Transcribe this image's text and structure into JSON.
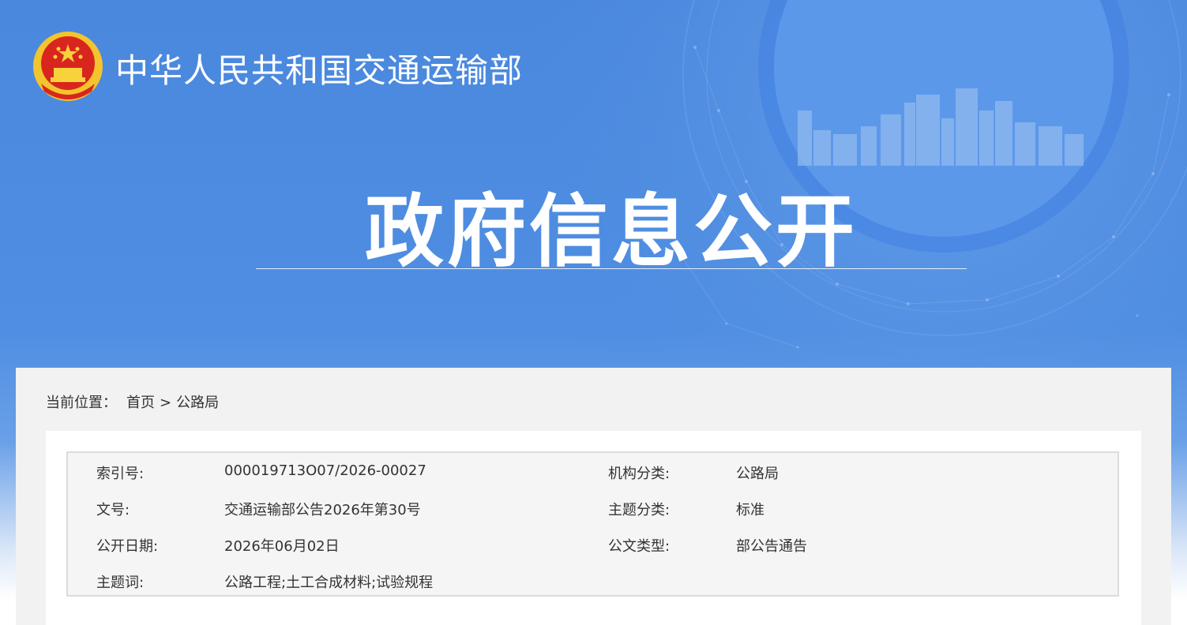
{
  "header": {
    "site_title": "中华人民共和国交通运输部",
    "section_title": "政府信息公开",
    "emblem": "national-emblem-icon"
  },
  "breadcrumb": {
    "prefix": "当前位置：",
    "home": "首页",
    "separator": ">",
    "current": "公路局"
  },
  "info": {
    "index_label": "索引号:",
    "index_value": "000019713O07/2026-00027",
    "org_label": "机构分类:",
    "org_value": "公路局",
    "doc_no_label": "文号:",
    "doc_no_value": "交通运输部公告2026年第30号",
    "topic_label": "主题分类:",
    "topic_value": "标准",
    "date_label": "公开日期:",
    "date_value": "2026年06月02日",
    "type_label": "公文类型:",
    "type_value": "部公告通告",
    "keywords_label": "主题词:",
    "keywords_value": "公路工程;土工合成材料;试验规程"
  },
  "colors": {
    "banner_blue": "#4a88de",
    "panel_gray": "#f2f2f2",
    "text_dark": "#333333"
  }
}
